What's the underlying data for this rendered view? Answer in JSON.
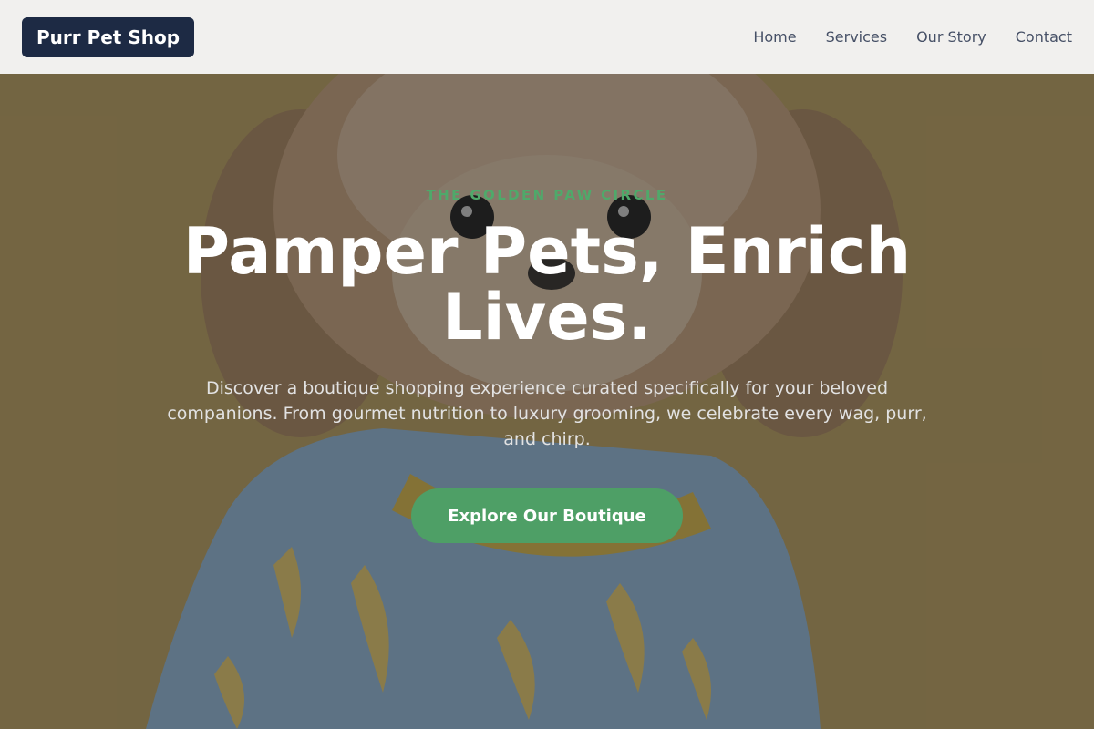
{
  "header": {
    "logo": "Purr Pet Shop",
    "nav": [
      "Home",
      "Services",
      "Our Story",
      "Contact"
    ]
  },
  "hero": {
    "eyebrow": "THE GOLDEN PAW CIRCLE",
    "headline": "Pamper Pets, Enrich Lives.",
    "subtitle": "Discover a boutique shopping experience curated specifically for your beloved companions. From gourmet nutrition to luxury grooming, we celebrate every wag, purr, and chirp.",
    "cta": "Explore Our Boutique"
  },
  "colors": {
    "header_bg": "#f1f0ee",
    "logo_bg": "#1d2a44",
    "accent_green": "#4e9f66",
    "nav_text": "#465066"
  }
}
